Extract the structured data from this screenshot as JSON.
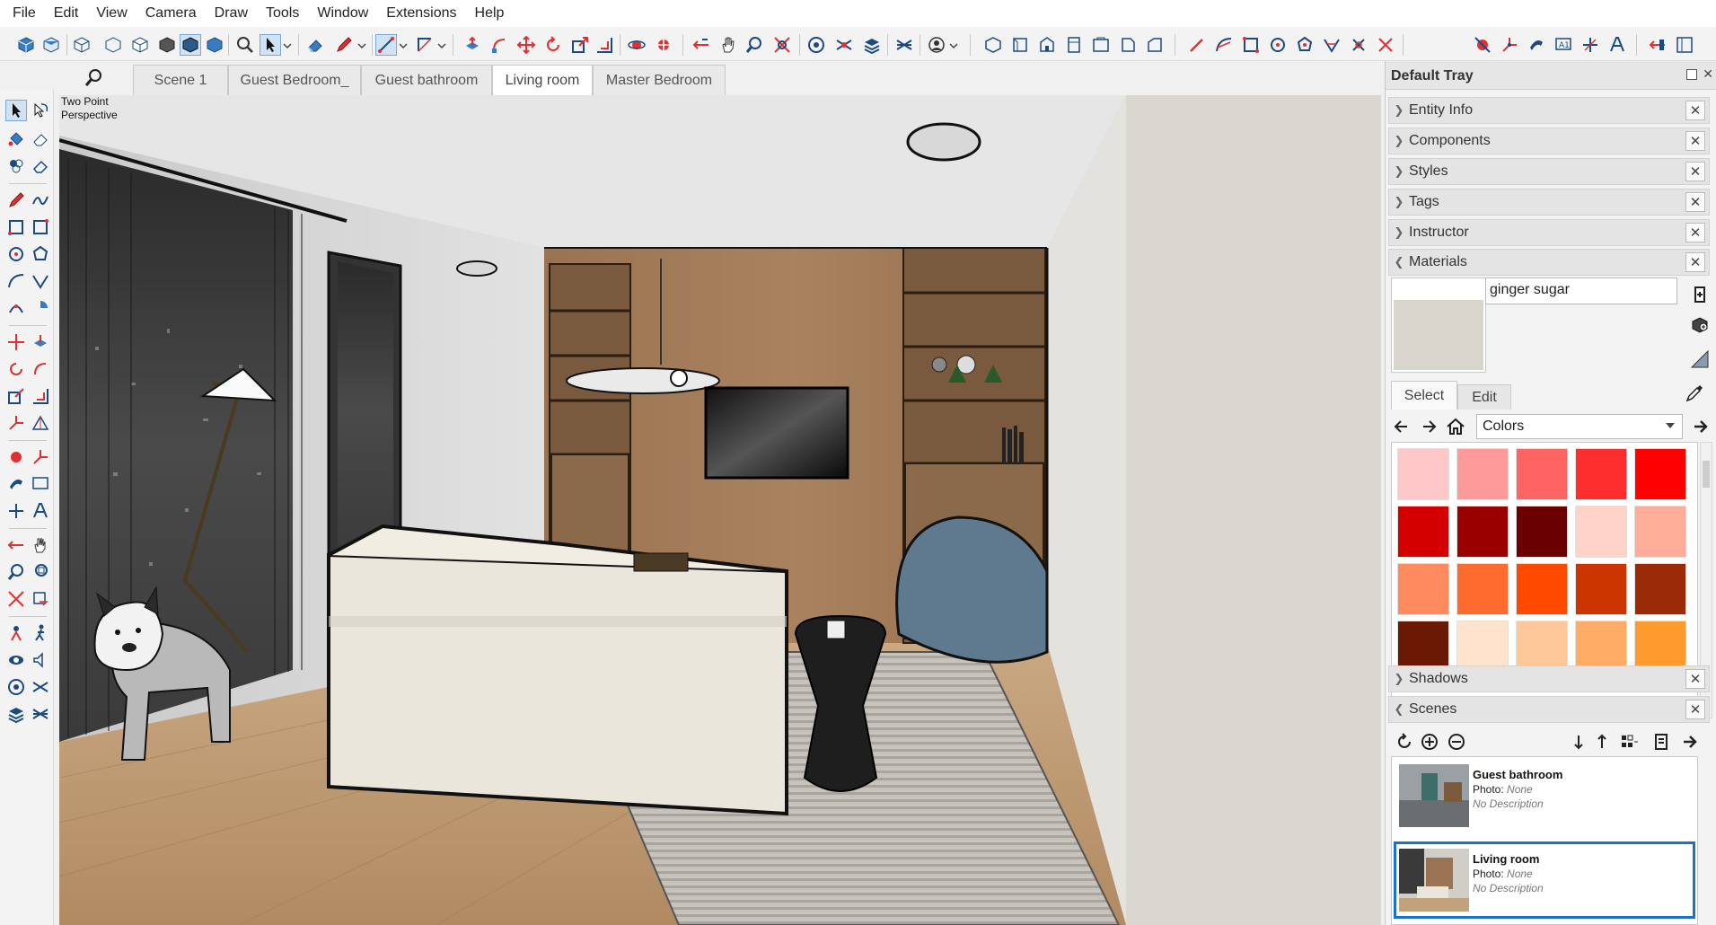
{
  "menu": [
    "File",
    "Edit",
    "View",
    "Camera",
    "Draw",
    "Tools",
    "Window",
    "Extensions",
    "Help"
  ],
  "viewport": {
    "label_line1": "Two Point",
    "label_line2": "Perspective"
  },
  "scene_tabs": [
    {
      "label": "Scene 1",
      "active": false
    },
    {
      "label": "Guest Bedroom_",
      "active": false
    },
    {
      "label": "Guest bathroom",
      "active": false
    },
    {
      "label": "Living room",
      "active": true
    },
    {
      "label": "Master Bedroom",
      "active": false
    }
  ],
  "tray": {
    "title": "Default Tray",
    "panels": {
      "entity_info": "Entity Info",
      "components": "Components",
      "styles": "Styles",
      "tags": "Tags",
      "instructor": "Instructor",
      "materials": "Materials",
      "shadows": "Shadows",
      "scenes": "Scenes"
    },
    "materials": {
      "name": "ginger sugar",
      "swatch_color": "#d8d6cc",
      "tabs": {
        "select": "Select",
        "edit": "Edit"
      },
      "library": "Colors",
      "swatches": [
        "#ffc8c8",
        "#ff9a9a",
        "#ff6464",
        "#ff2e2e",
        "#ff0000",
        "#d40000",
        "#9a0000",
        "#6a0000",
        "#ffd3c8",
        "#ffad99",
        "#ff8a5e",
        "#ff6a2e",
        "#ff4a00",
        "#cc3400",
        "#9a2a08",
        "#6a1a04",
        "#ffe3cc",
        "#ffc89a",
        "#ffad66",
        "#ff9a2e"
      ]
    },
    "scenes": [
      {
        "name": "Guest bathroom",
        "photo_label": "Photo:",
        "photo_value": "None",
        "description": "No Description",
        "active": false
      },
      {
        "name": "Living room",
        "photo_label": "Photo:",
        "photo_value": "None",
        "description": "No Description",
        "active": true
      }
    ]
  }
}
